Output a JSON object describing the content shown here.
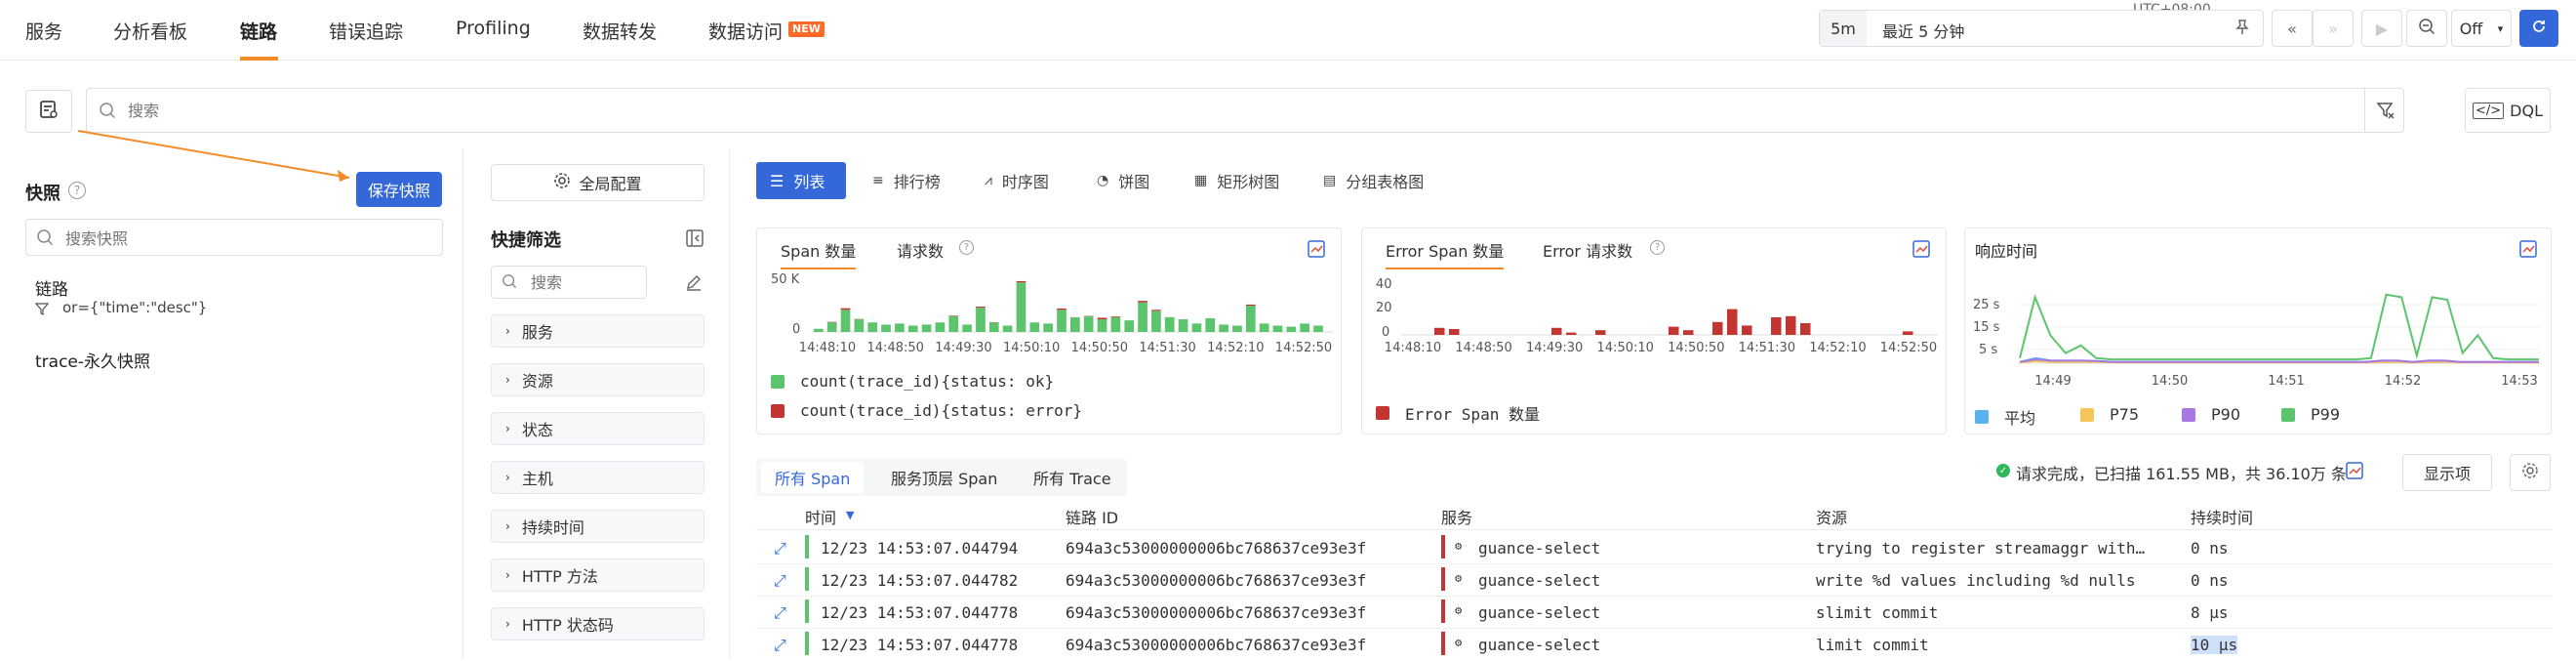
{
  "nav": {
    "items": [
      "服务",
      "分析看板",
      "链路",
      "错误追踪",
      "Profiling",
      "数据转发",
      "数据访问"
    ],
    "active": "链路",
    "new_badge": "NEW"
  },
  "time": {
    "timezone": "UTC+08:00",
    "quick": "5m",
    "range": "最近 5 分钟",
    "refresh": "Off"
  },
  "search": {
    "placeholder": "搜索",
    "dql": "DQL"
  },
  "snapshot": {
    "title": "快照",
    "save": "保存快照",
    "search_placeholder": "搜索快照",
    "items": [
      {
        "name": "链路",
        "filter": "or={\"time\":\"desc\"}"
      },
      {
        "name": "trace-永久快照"
      }
    ]
  },
  "filters": {
    "global_config": "全局配置",
    "title": "快捷筛选",
    "search_placeholder": "搜索",
    "items": [
      "服务",
      "资源",
      "状态",
      "主机",
      "持续时间",
      "HTTP 方法",
      "HTTP 状态码"
    ]
  },
  "view_tabs": [
    "列表",
    "排行榜",
    "时序图",
    "饼图",
    "矩形树图",
    "分组表格图"
  ],
  "charts": {
    "span_count": {
      "tabs": [
        "Span 数量",
        "请求数"
      ],
      "legend": [
        "count(trace_id){status: ok}",
        "count(trace_id){status: error}"
      ],
      "colors": [
        "#5cc46d",
        "#c23531"
      ]
    },
    "error_span": {
      "tabs": [
        "Error Span 数量",
        "Error 请求数"
      ],
      "legend": [
        "Error Span 数量"
      ],
      "colors": [
        "#c23531"
      ]
    },
    "response_time": {
      "title": "响应时间",
      "legend": [
        "平均",
        "P75",
        "P90",
        "P99"
      ],
      "colors": [
        "#5ab1ef",
        "#f5c65a",
        "#a777e3",
        "#5cc46d"
      ]
    }
  },
  "chart_data": [
    {
      "type": "bar",
      "stacked": true,
      "x_ticks": [
        "14:48:10",
        "14:48:50",
        "14:49:30",
        "14:50:10",
        "14:50:50",
        "14:51:30",
        "14:52:10",
        "14:52:50"
      ],
      "y_ticks": [
        "50 K",
        "0"
      ],
      "ylim": [
        0,
        50000
      ],
      "series": [
        {
          "name": "count(trace_id){status: ok}",
          "values": [
            3000,
            9000,
            21000,
            12000,
            9000,
            7000,
            8000,
            6000,
            7000,
            9000,
            15000,
            7000,
            23000,
            9000,
            6000,
            47000,
            9000,
            8000,
            21000,
            14000,
            15000,
            12000,
            14000,
            11000,
            28000,
            20000,
            14000,
            12000,
            8000,
            13000,
            7000,
            6000,
            25000,
            8000,
            6000,
            5000,
            8000,
            6000
          ]
        },
        {
          "name": "count(trace_id){status: error}",
          "values": [
            0,
            500,
            1500,
            300,
            0,
            0,
            0,
            0,
            0,
            0,
            500,
            0,
            1000,
            300,
            0,
            1200,
            0,
            0,
            1300,
            0,
            300,
            1500,
            700,
            0,
            1500,
            1000,
            0,
            0,
            0,
            0,
            0,
            0,
            1000,
            0,
            0,
            0,
            0,
            0
          ]
        }
      ]
    },
    {
      "type": "bar",
      "x_ticks": [
        "14:48:10",
        "14:48:50",
        "14:49:30",
        "14:50:10",
        "14:50:50",
        "14:51:30",
        "14:52:10",
        "14:52:50"
      ],
      "y_ticks": [
        "40",
        "20",
        "0"
      ],
      "ylim": [
        0,
        40
      ],
      "series": [
        {
          "name": "Error Span 数量",
          "values": [
            0,
            0,
            6,
            5,
            0,
            0,
            0,
            0,
            0,
            0,
            6,
            2,
            0,
            4,
            0,
            0,
            0,
            0,
            7,
            4,
            0,
            11,
            22,
            8,
            0,
            15,
            16,
            10,
            0,
            0,
            0,
            0,
            0,
            0,
            3,
            0
          ]
        }
      ]
    },
    {
      "type": "line",
      "x_ticks": [
        "14:49",
        "14:50",
        "14:51",
        "14:52",
        "14:53"
      ],
      "y_ticks": [
        "25 s",
        "15 s",
        "5 s"
      ],
      "ylim": [
        0,
        30
      ],
      "series": [
        {
          "name": "平均",
          "values": [
            0.5,
            2,
            1,
            1,
            1,
            0.8,
            0.5,
            0.5,
            0.5,
            0.5,
            0.5,
            0.5,
            0.5,
            0.5,
            0.5,
            0.5,
            0.5,
            0.5,
            0.5,
            0.5,
            0.5,
            0.5,
            0.5,
            1,
            1,
            0.5,
            1,
            1,
            0.5,
            0.5,
            0.5,
            0.5,
            0.5,
            0.5
          ]
        },
        {
          "name": "P75",
          "values": [
            0.3,
            0.8,
            0.5,
            0.5,
            0.5,
            0.5,
            0.3,
            0.3,
            0.3,
            0.3,
            0.3,
            0.3,
            0.3,
            0.3,
            0.3,
            0.3,
            0.3,
            0.3,
            0.3,
            0.3,
            0.3,
            0.3,
            0.3,
            0.5,
            0.5,
            0.3,
            0.5,
            0.5,
            0.3,
            0.3,
            0.3,
            0.3,
            0.3,
            0.3
          ]
        },
        {
          "name": "P90",
          "values": [
            0.5,
            1.5,
            1,
            1,
            1,
            0.8,
            0.5,
            0.5,
            0.5,
            0.5,
            0.5,
            0.5,
            0.5,
            0.5,
            0.5,
            0.5,
            0.5,
            0.5,
            0.5,
            0.5,
            0.5,
            0.5,
            0.5,
            1,
            1,
            0.5,
            1,
            1,
            0.5,
            0.5,
            0.5,
            0.5,
            0.5,
            0.5
          ]
        },
        {
          "name": "P99",
          "values": [
            2,
            26,
            11,
            4,
            7,
            2,
            1.5,
            1.5,
            1.5,
            1.5,
            1.5,
            1.5,
            1.5,
            1.5,
            1.5,
            1.5,
            1.5,
            1.5,
            1.5,
            1.5,
            1.5,
            1.5,
            1.5,
            2,
            27,
            26,
            3,
            26,
            25,
            4,
            11,
            2,
            1.5,
            1.5,
            1.5
          ]
        }
      ]
    }
  ],
  "status": {
    "text": "请求完成，已扫描 161.55 MB，共 36.10万 条",
    "display": "显示项"
  },
  "span_tabs": [
    "所有 Span",
    "服务顶层 Span",
    "所有 Trace"
  ],
  "table": {
    "columns": [
      "时间",
      "链路 ID",
      "服务",
      "资源",
      "持续时间"
    ],
    "rows": [
      [
        "12/23 14:53:07.044794",
        "694a3c53000000006bc768637ce93e3f",
        "guance-select",
        "trying to register streamaggr with…",
        "0 ns"
      ],
      [
        "12/23 14:53:07.044782",
        "694a3c53000000006bc768637ce93e3f",
        "guance-select",
        "write %d values including %d nulls",
        "0 ns"
      ],
      [
        "12/23 14:53:07.044778",
        "694a3c53000000006bc768637ce93e3f",
        "guance-select",
        "slimit commit",
        "8 μs"
      ],
      [
        "12/23 14:53:07.044778",
        "694a3c53000000006bc768637ce93e3f",
        "guance-select",
        "limit commit",
        "10 μs"
      ]
    ]
  }
}
